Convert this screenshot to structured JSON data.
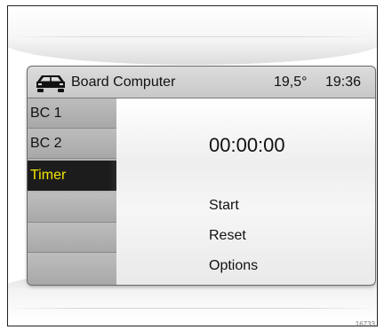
{
  "header": {
    "title": "Board Computer",
    "temperature": "19,5°",
    "time": "19:36",
    "icon": "car-icon"
  },
  "sidebar": {
    "items": [
      {
        "label": "BC 1",
        "selected": false
      },
      {
        "label": "BC 2",
        "selected": false
      },
      {
        "label": "Timer",
        "selected": true
      },
      {
        "label": "",
        "selected": false
      },
      {
        "label": "",
        "selected": false
      },
      {
        "label": "",
        "selected": false
      }
    ]
  },
  "main": {
    "timer_value": "00:00:00",
    "actions": [
      {
        "label": "Start"
      },
      {
        "label": "Reset"
      },
      {
        "label": "Options"
      }
    ]
  },
  "caption": "16733",
  "colors": {
    "selected_text": "#f2e400",
    "selected_bg": "#1c1c1c",
    "sidebar_bg": "#b4b4b4",
    "titlebar_bg": "#d2d2d2"
  }
}
